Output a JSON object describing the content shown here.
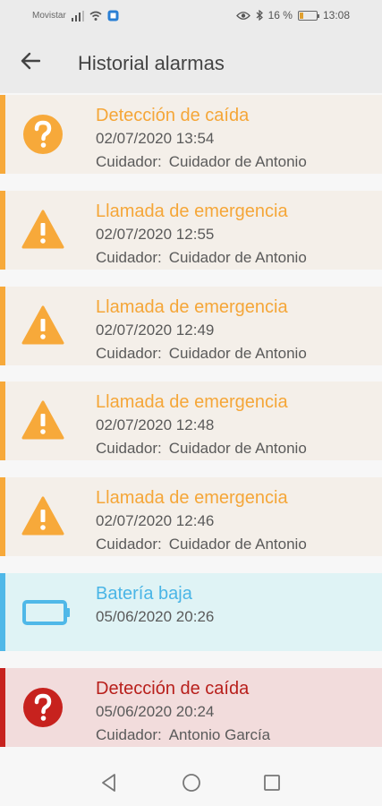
{
  "status": {
    "carrier": "Movistar",
    "battery_pct": "16 %",
    "time": "13:08"
  },
  "header": {
    "title": "Historial alarmas"
  },
  "colors": {
    "orange": "#f7a93a",
    "blue": "#4fb8e8",
    "red": "#c7221e"
  },
  "alarms": [
    {
      "type": "Detección de caída",
      "datetime": "02/07/2020 13:54",
      "caregiver_label": "Cuidador:",
      "caregiver": "Cuidador de Antonio",
      "icon": "question-icon",
      "tone": "orange"
    },
    {
      "type": "Llamada de emergencia",
      "datetime": "02/07/2020 12:55",
      "caregiver_label": "Cuidador:",
      "caregiver": "Cuidador de Antonio",
      "icon": "warning-icon",
      "tone": "orange"
    },
    {
      "type": "Llamada de emergencia",
      "datetime": "02/07/2020 12:49",
      "caregiver_label": "Cuidador:",
      "caregiver": "Cuidador de Antonio",
      "icon": "warning-icon",
      "tone": "orange"
    },
    {
      "type": "Llamada de emergencia",
      "datetime": "02/07/2020 12:48",
      "caregiver_label": "Cuidador:",
      "caregiver": "Cuidador de Antonio",
      "icon": "warning-icon",
      "tone": "orange"
    },
    {
      "type": "Llamada de emergencia",
      "datetime": "02/07/2020 12:46",
      "caregiver_label": "Cuidador:",
      "caregiver": "Cuidador de Antonio",
      "icon": "warning-icon",
      "tone": "orange"
    },
    {
      "type": "Batería baja",
      "datetime": "05/06/2020 20:26",
      "icon": "battery-low-icon",
      "tone": "blue"
    },
    {
      "type": "Detección de caída",
      "datetime": "05/06/2020 20:24",
      "caregiver_label": "Cuidador:",
      "caregiver": "Antonio García",
      "icon": "question-icon",
      "tone": "red"
    }
  ]
}
